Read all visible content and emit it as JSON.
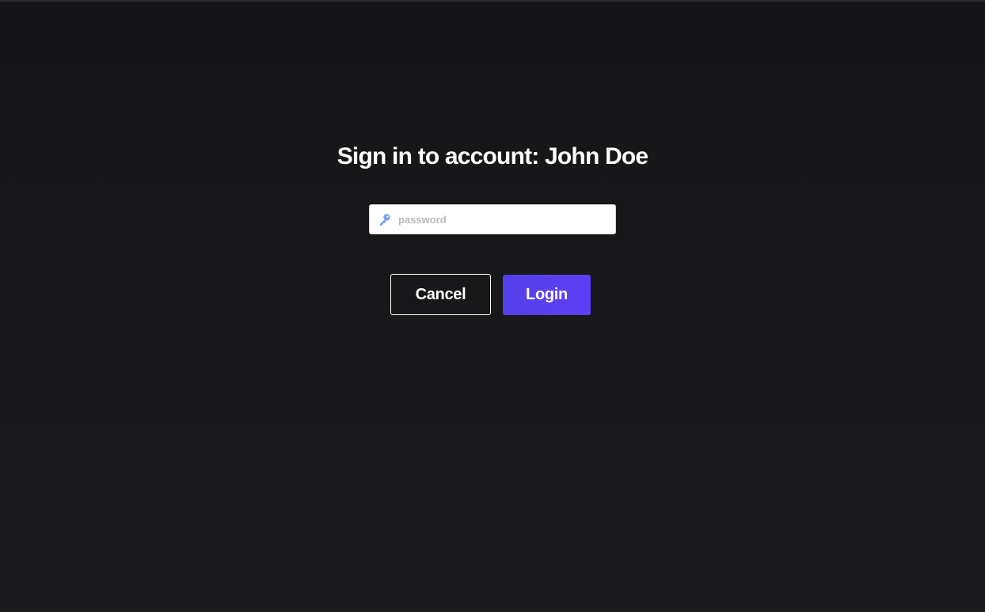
{
  "dialog": {
    "title": "Sign in to account: John Doe",
    "password": {
      "value": "",
      "placeholder": "password",
      "icon": "key-icon"
    },
    "cancel_label": "Cancel",
    "login_label": "Login"
  },
  "colors": {
    "background": "#19191b",
    "title_text": "#ffffff",
    "input_background": "#ffffff",
    "placeholder": "#b9b9b9",
    "key_icon": "#7a9fe0",
    "login_button": "#5a40ee",
    "cancel_border": "#ffffff"
  }
}
